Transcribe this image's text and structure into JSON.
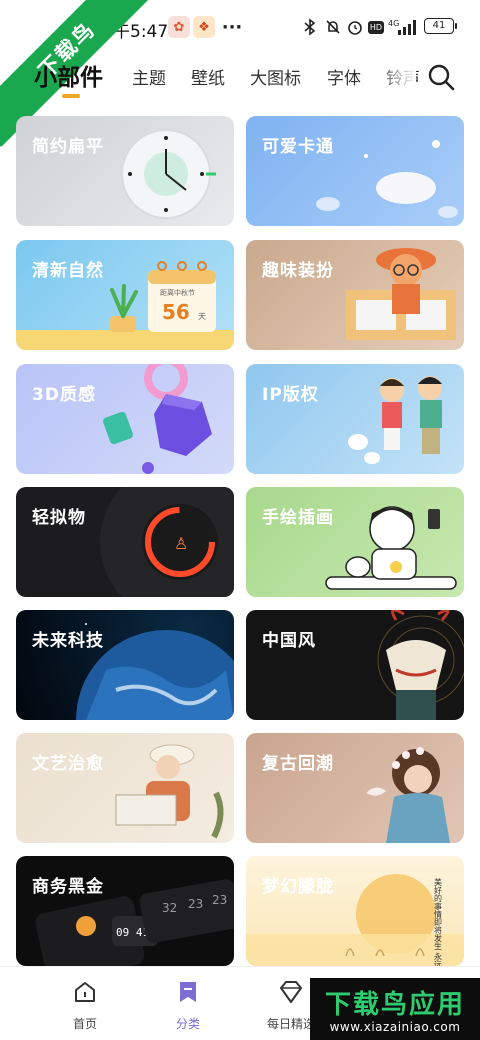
{
  "status_bar": {
    "time": "下午5:47",
    "dots": "···",
    "network": "4G",
    "hd": "HD",
    "battery": "41"
  },
  "watermark": {
    "ribbon_text": "下载鸟"
  },
  "tabs": [
    {
      "label": "小部件",
      "active": true
    },
    {
      "label": "主题",
      "active": false
    },
    {
      "label": "壁纸",
      "active": false
    },
    {
      "label": "大图标",
      "active": false
    },
    {
      "label": "字体",
      "active": false
    },
    {
      "label": "铃声",
      "active": false
    }
  ],
  "cards": [
    {
      "title": "简约扁平",
      "theme": "clock"
    },
    {
      "title": "可爱卡通",
      "theme": "cartoon"
    },
    {
      "title": "清新自然",
      "theme": "calendar",
      "art_text": "距离中秋节",
      "art_number": "56",
      "art_unit": "天"
    },
    {
      "title": "趣味装扮",
      "theme": "dressup"
    },
    {
      "title": "3D质感",
      "theme": "shapes"
    },
    {
      "title": "IP版权",
      "theme": "ip"
    },
    {
      "title": "轻拟物",
      "theme": "dial"
    },
    {
      "title": "手绘插画",
      "theme": "sketch"
    },
    {
      "title": "未来科技",
      "theme": "earth"
    },
    {
      "title": "中国风",
      "theme": "deer"
    },
    {
      "title": "文艺治愈",
      "theme": "artsy"
    },
    {
      "title": "复古回潮",
      "theme": "retro"
    },
    {
      "title": "商务黑金",
      "theme": "business",
      "art_numbers": [
        "32",
        "23",
        "23"
      ],
      "art_time": "09 41"
    },
    {
      "title": "梦幻朦胧",
      "theme": "dreamy",
      "art_poem": "美好的事情即将发生 永远相信"
    }
  ],
  "bottom_nav": [
    {
      "label": "首页",
      "icon": "home-icon"
    },
    {
      "label": "分类",
      "icon": "category-icon",
      "active": true
    },
    {
      "label": "每日精选",
      "icon": "diamond-icon"
    }
  ],
  "app_banner": {
    "title": "下载鸟应用",
    "url": "www.xiazainiao.com"
  },
  "colors": {
    "accent": "#f5a623",
    "active_nav": "#7b6fd6"
  }
}
